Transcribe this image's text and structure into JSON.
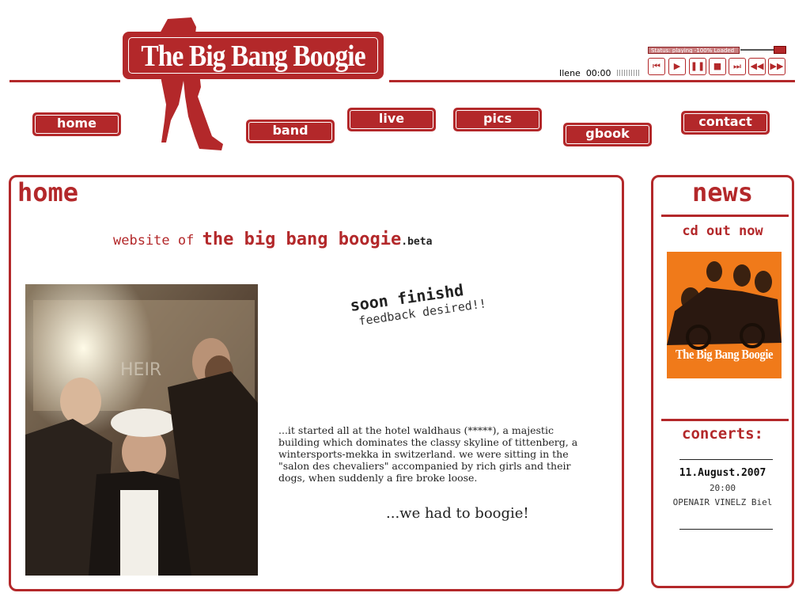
{
  "logo": {
    "text": "The Big Bang Boogie"
  },
  "nav": [
    {
      "label": "home"
    },
    {
      "label": "band"
    },
    {
      "label": "live"
    },
    {
      "label": "pics"
    },
    {
      "label": "gbook"
    },
    {
      "label": "contact"
    }
  ],
  "player": {
    "status": "Status: playing -100% Loaded",
    "track": "Ilene",
    "time": "00:00",
    "controls": [
      "prev-icon",
      "play-icon",
      "pause-icon",
      "stop-icon",
      "next-icon",
      "rewind-icon",
      "fast-forward-icon"
    ]
  },
  "main": {
    "title": "home",
    "tagline_prefix": "website of ",
    "tagline_name": "the big bang boogie",
    "tagline_suffix": ".beta",
    "soon": "soon finishd",
    "feedback": "feedback desired!!",
    "story": "...it started all at the hotel waldhaus (*****), a majestic building which dominates the classy skyline of tittenberg, a wintersports-mekka in switzerland. we were sitting in the \"salon des chevaliers\" accompanied by rich girls and their dogs, when suddenly a fire broke loose.",
    "boogie": "...we had to boogie!",
    "photo_sign": "HEIR"
  },
  "news": {
    "title": "news",
    "cd_out": "cd out now",
    "cover_text": "The Big Bang Boogie",
    "concerts_title": "concerts:",
    "concert": {
      "date": "11.August.2007",
      "time": "20:00",
      "place": "OPENAIR VINELZ Biel"
    }
  },
  "colors": {
    "brand": "#b3282a",
    "cover": "#f07a1a"
  }
}
